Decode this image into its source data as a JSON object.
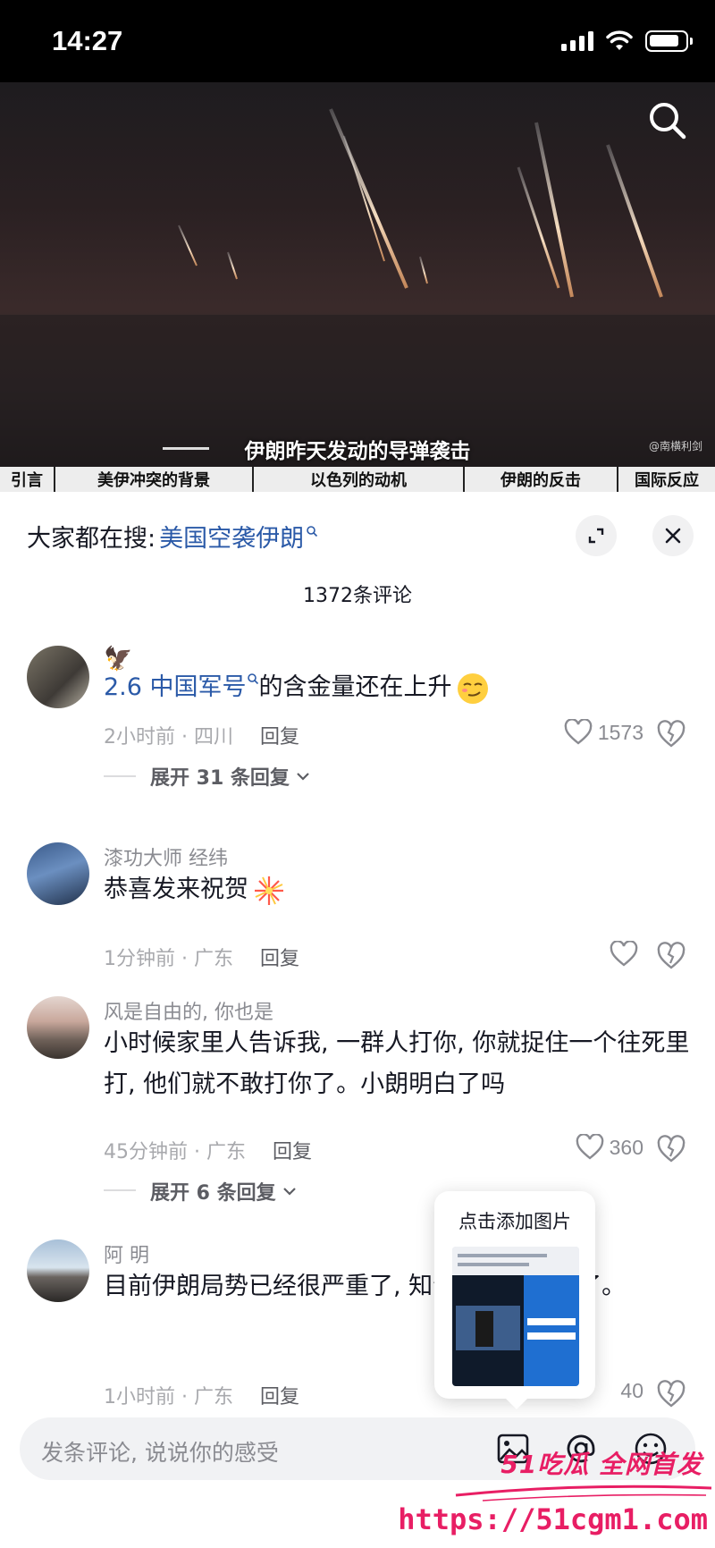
{
  "status_bar": {
    "time": "14:27"
  },
  "video": {
    "caption": "伊朗昨天发动的导弹袭击",
    "watermark": "@南横利剑",
    "chapters": [
      "引言",
      "美伊冲突的背景",
      "以色列的动机",
      "伊朗的反击",
      "国际反应"
    ]
  },
  "sheet": {
    "hot_search_prefix": "大家都在搜:",
    "hot_search_term": "美国空袭伊朗",
    "comment_count": "1372条评论"
  },
  "comments": [
    {
      "name": "🦅",
      "text_link": "2.6 中国军号",
      "text_rest": "的含金量还在上升",
      "time_location": "2小时前 · 四川",
      "reply": "回复",
      "likes": "1573",
      "expand": "展开 31 条回复"
    },
    {
      "name": "漆功大师 经纬",
      "text": "恭喜发来祝贺",
      "time_location": "1分钟前 · 广东",
      "reply": "回复",
      "likes": ""
    },
    {
      "name": "风是自由的, 你也是",
      "text": "小时候家里人告诉我, 一群人打你, 你就捉住一个往死里打, 他们就不敢打你了。小朗明白了吗",
      "time_location": "45分钟前 · 广东",
      "reply": "回复",
      "likes": "360",
      "expand": "展开 6 条回复"
    },
    {
      "name": "阿 明",
      "text": "目前伊朗局势已经很严重了,                                    知今天不用上班了。",
      "time_location": "1小时前 · 广东",
      "reply": "回复",
      "likes": "40"
    }
  ],
  "popup": {
    "title": "点击添加图片"
  },
  "input_bar": {
    "placeholder": "发条评论, 说说你的感受"
  },
  "site_mark": {
    "brand": "51吃瓜 全网首发",
    "url": "https://51cgm1.com"
  },
  "colors": {
    "link": "#2b5aa8",
    "brand": "#e81e64"
  }
}
